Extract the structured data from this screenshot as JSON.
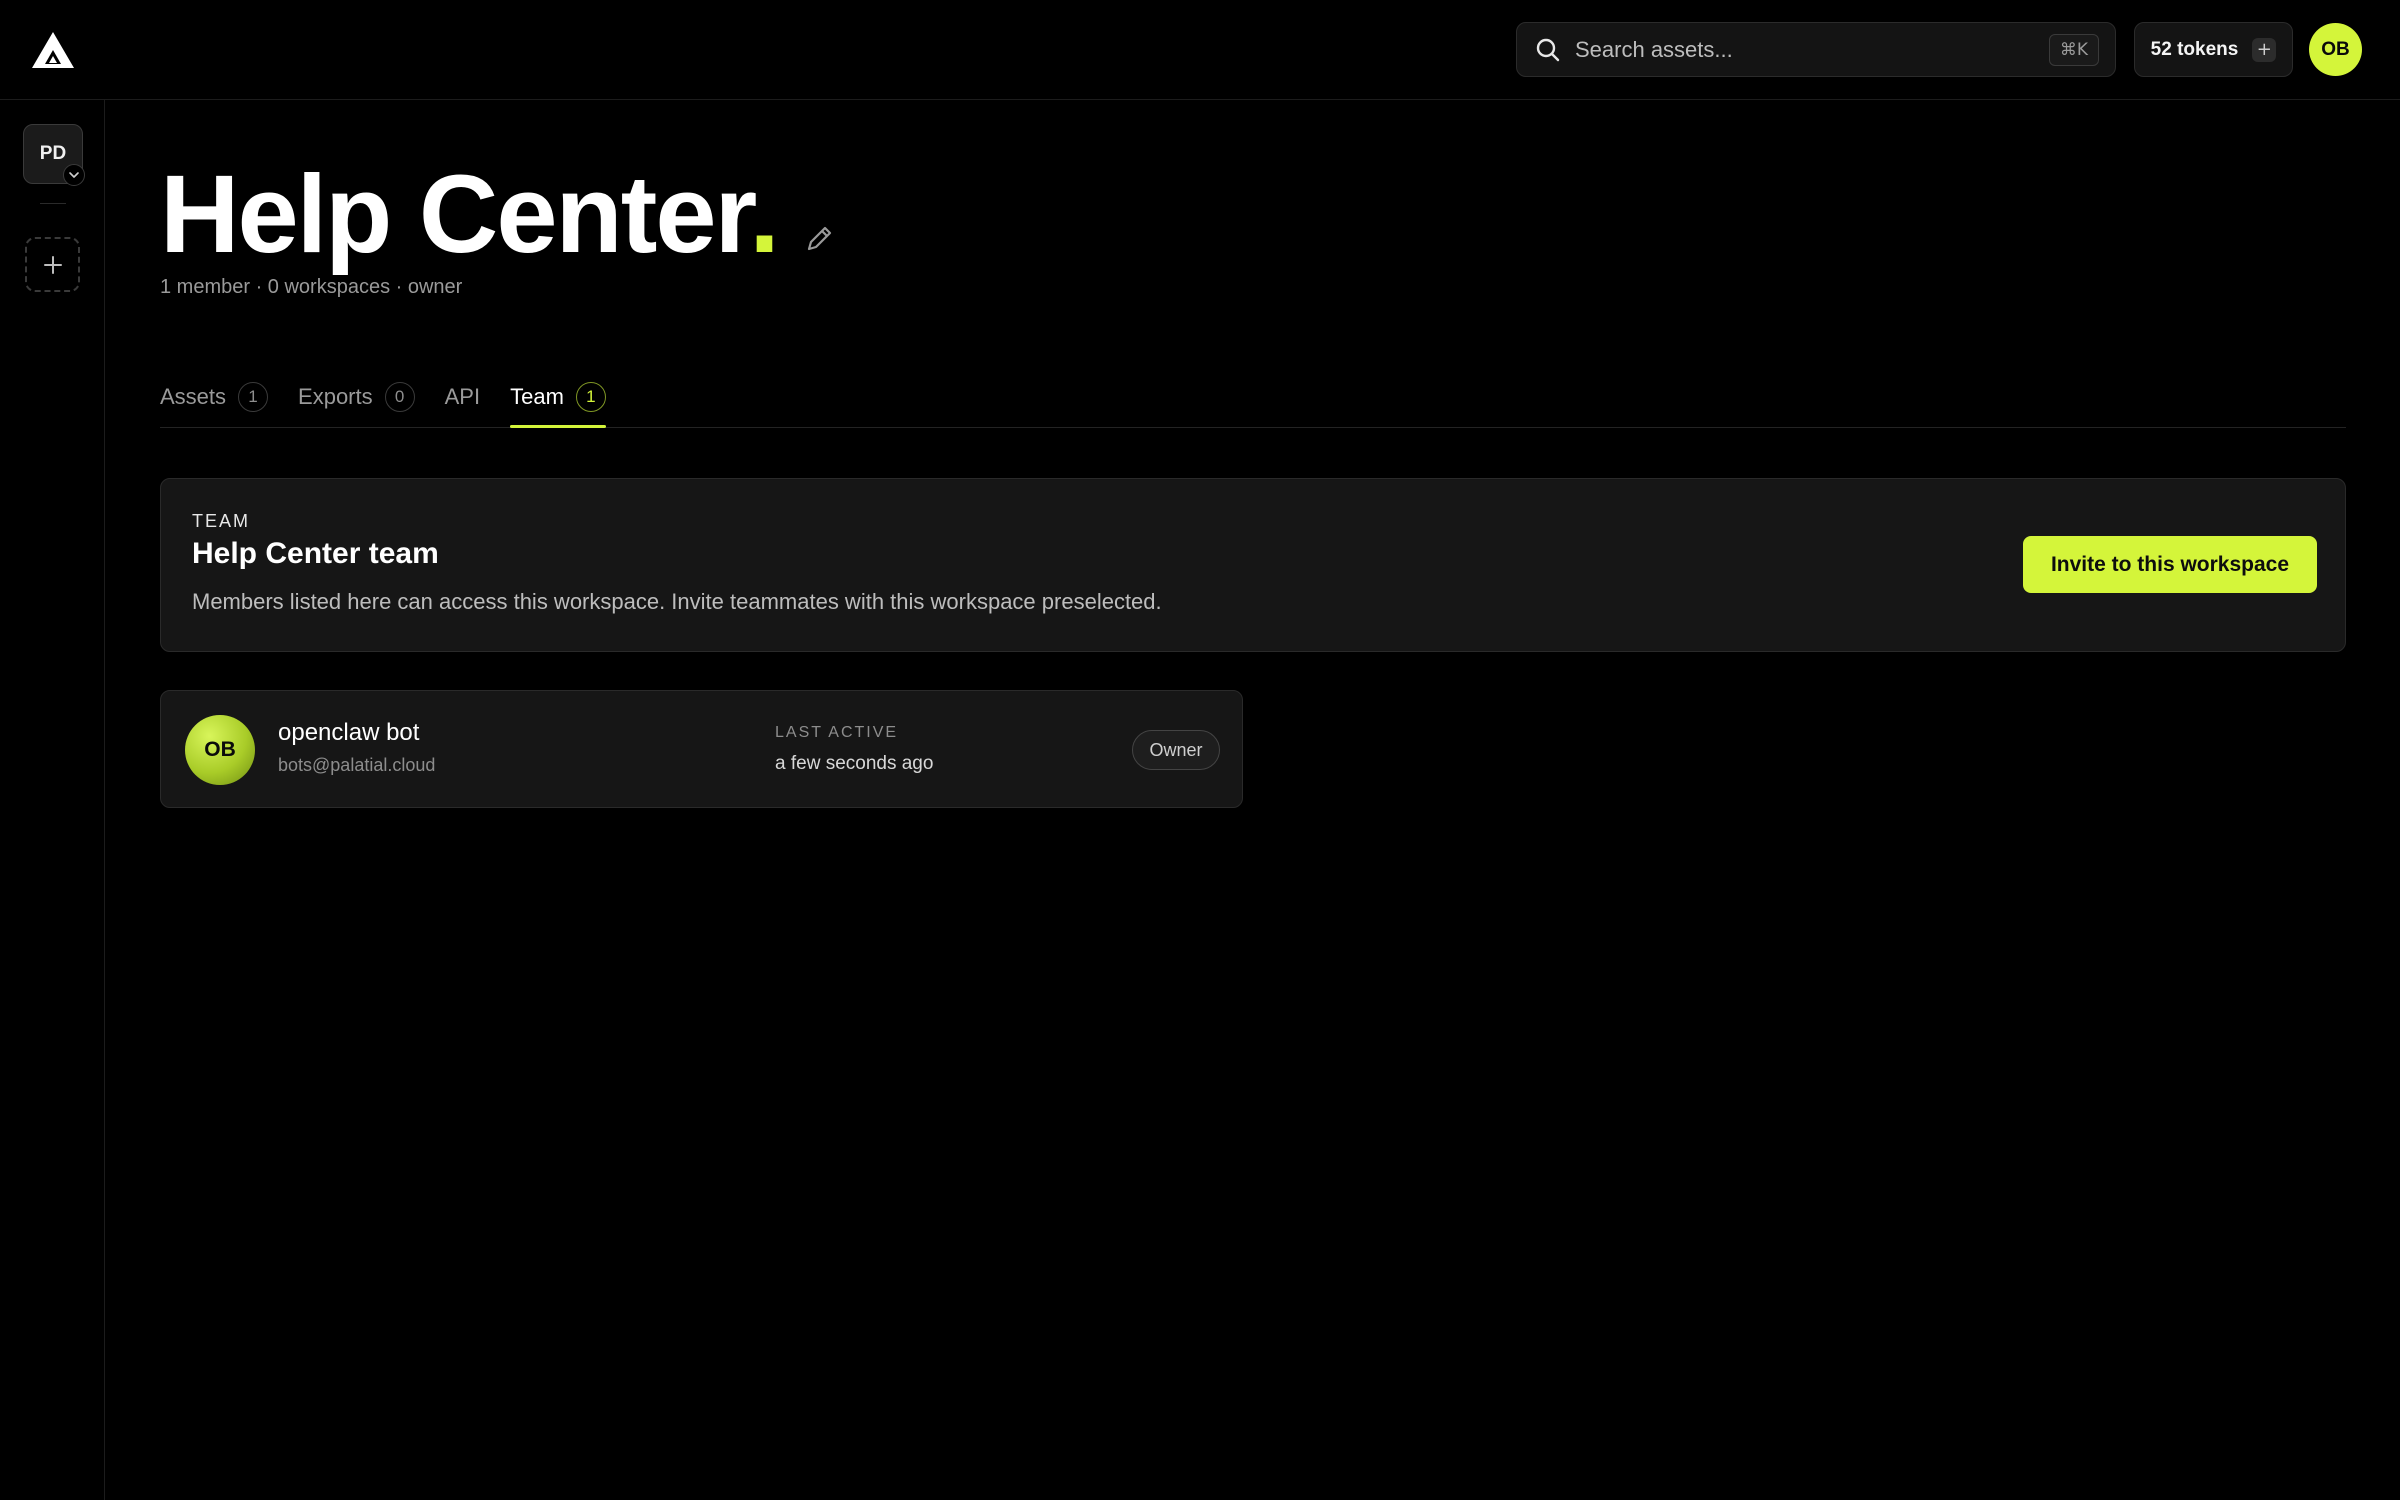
{
  "app": {
    "logo_icon": "triangle-logo-icon"
  },
  "topbar": {
    "search": {
      "placeholder": "Search assets...",
      "shortcut": "⌘K",
      "icon": "search-icon"
    },
    "tokens": {
      "label": "52 tokens",
      "add_label": "+"
    },
    "user_initials": "OB"
  },
  "sidebar": {
    "workspace_initials": "PD",
    "workspace_menu_icon": "chevron-down-icon",
    "add_workspace_icon": "plus-icon"
  },
  "page": {
    "title": "Help Center",
    "title_dot": ".",
    "accent_color": "#d4f53a",
    "edit_icon": "pencil-icon",
    "subtitle": "1 member · 0 workspaces · owner"
  },
  "tabs": [
    {
      "label": "Assets",
      "count": "1",
      "active": false
    },
    {
      "label": "Exports",
      "count": "0",
      "active": false
    },
    {
      "label": "API",
      "count": null,
      "active": false
    },
    {
      "label": "Team",
      "count": "1",
      "active": true
    }
  ],
  "team_panel": {
    "eyebrow": "TEAM",
    "title": "Help Center team",
    "description": "Members listed here can access this workspace. Invite teammates with this workspace preselected.",
    "invite_label": "Invite to this workspace"
  },
  "members": [
    {
      "initials": "OB",
      "name": "openclaw bot",
      "email": "bots@palatial.cloud",
      "last_active_label": "LAST ACTIVE",
      "last_active": "a few seconds ago",
      "role": "Owner"
    }
  ]
}
